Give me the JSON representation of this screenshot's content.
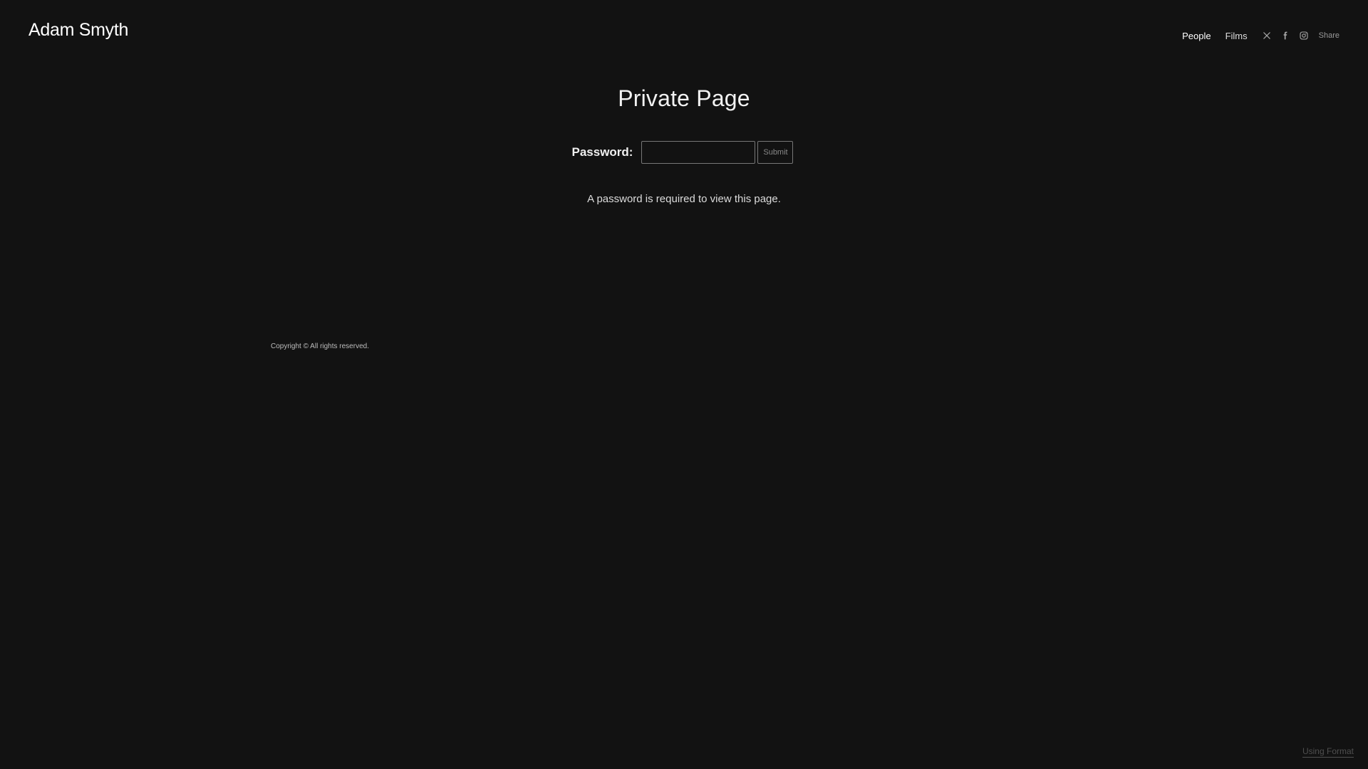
{
  "header": {
    "site_title": "Adam Smyth",
    "nav": {
      "items": [
        {
          "label": "People",
          "active": true
        },
        {
          "label": "Films",
          "active": false
        }
      ],
      "social_icons": [
        "x-twitter-icon",
        "facebook-icon",
        "instagram-icon"
      ],
      "share_label": "Share"
    }
  },
  "main": {
    "heading": "Private Page",
    "form": {
      "password_label": "Password:",
      "password_value": "",
      "submit_label": "Submit"
    },
    "help_text": "A password is required to view this page."
  },
  "footer": {
    "copyright": "Copyright © All rights reserved.",
    "format_link": "Using Format"
  },
  "colors": {
    "background": "#121212",
    "text": "#e8e8e8",
    "border": "#777777"
  }
}
